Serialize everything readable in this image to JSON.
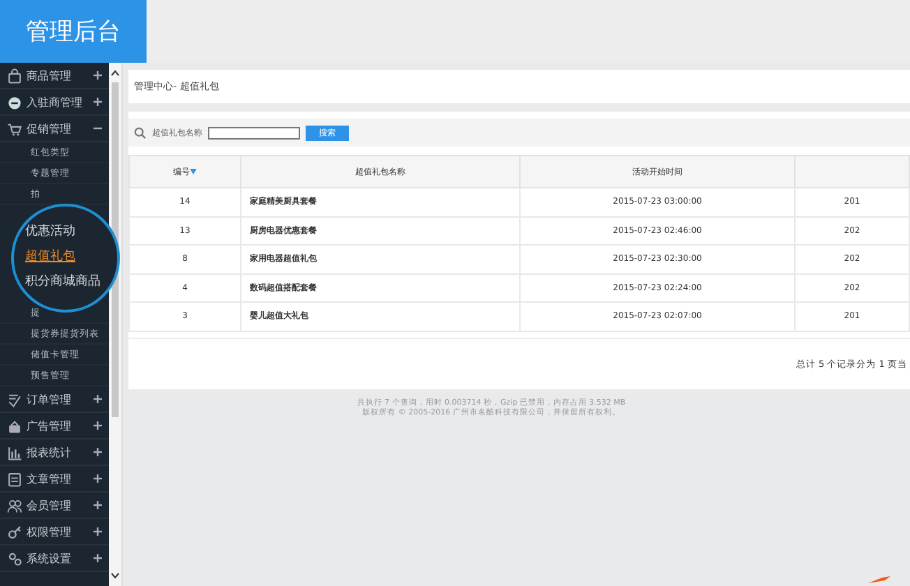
{
  "header": {
    "title": "管理后台"
  },
  "sidebar": {
    "items": [
      {
        "label": "商品管理",
        "expanded": false
      },
      {
        "label": "入驻商管理",
        "expanded": false
      },
      {
        "label": "促销管理",
        "expanded": true,
        "children": [
          {
            "label": "红包类型"
          },
          {
            "label": "专题管理"
          },
          {
            "label": "拍"
          },
          {
            "kind": "lens"
          },
          {
            "label": "提"
          },
          {
            "label": "提货券提货列表"
          },
          {
            "label": "储值卡管理"
          },
          {
            "label": "预售管理"
          }
        ]
      },
      {
        "label": "订单管理",
        "expanded": false
      },
      {
        "label": "广告管理",
        "expanded": false
      },
      {
        "label": "报表统计",
        "expanded": false
      },
      {
        "label": "文章管理",
        "expanded": false
      },
      {
        "label": "会员管理",
        "expanded": false
      },
      {
        "label": "权限管理",
        "expanded": false
      },
      {
        "label": "系统设置",
        "expanded": false
      }
    ]
  },
  "magnifier": {
    "items": [
      {
        "label": "优惠活动",
        "selected": false
      },
      {
        "label": "超值礼包",
        "selected": true
      },
      {
        "label": "积分商城商品",
        "selected": false
      }
    ]
  },
  "breadcrumb": "管理中心- 超值礼包",
  "search": {
    "label": "超值礼包名称",
    "button": "搜索"
  },
  "table": {
    "columns": [
      {
        "label": "编号",
        "sorted": true
      },
      {
        "label": "超值礼包名称",
        "sorted": false
      },
      {
        "label": "活动开始时间",
        "sorted": false
      },
      {
        "sorted": false
      }
    ],
    "rows": [
      [
        "14",
        "家庭精美厨具套餐",
        "2015-07-23 03:00:00",
        "201"
      ],
      [
        "13",
        "厨房电器优惠套餐",
        "2015-07-23 02:46:00",
        "202"
      ],
      [
        "8",
        "家用电器超值礼包",
        "2015-07-23 02:30:00",
        "202"
      ],
      [
        "4",
        "数码超值搭配套餐",
        "2015-07-23 02:24:00",
        "202"
      ],
      [
        "3",
        "婴儿超值大礼包",
        "2015-07-23 02:07:00",
        "201"
      ]
    ]
  },
  "pager": "总计 5 个记录分为 1 页当",
  "footer": [
    "共执行 7 个查询，用时 0.003714 秒，Gzip 已禁用，内存占用 3.532 MB",
    "版权所有 © 2005-2016 广州市名酷科技有限公司，并保留所有权利。"
  ]
}
